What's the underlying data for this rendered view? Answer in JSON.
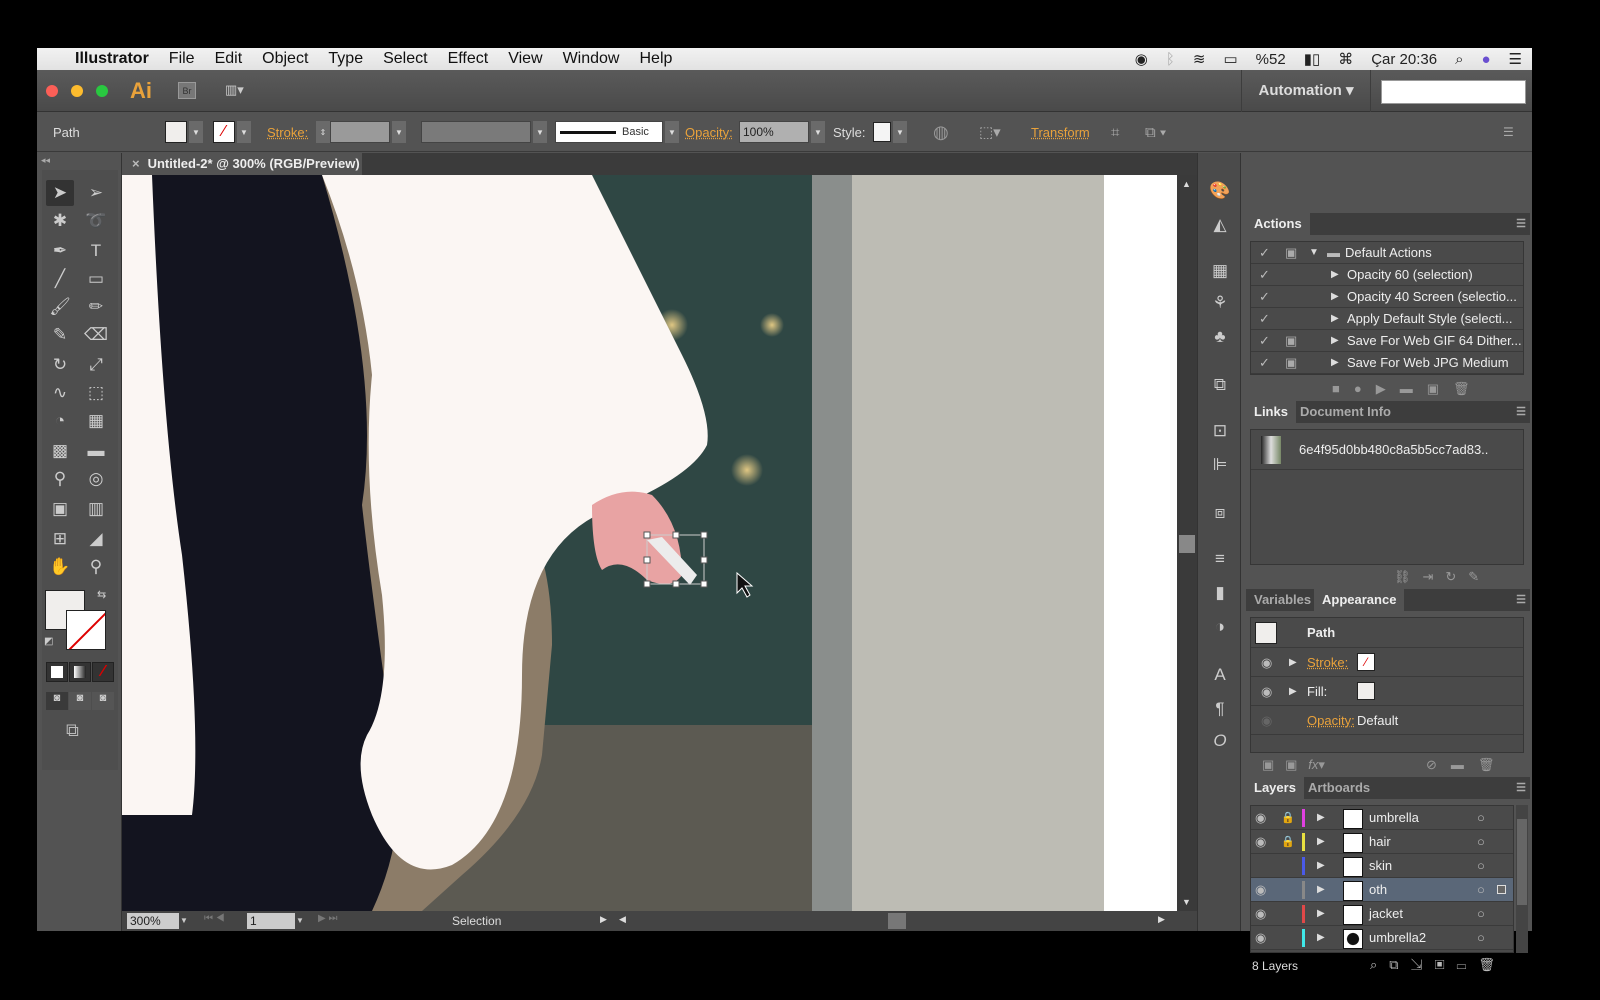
{
  "menubar": {
    "app": "Illustrator",
    "items": [
      "File",
      "Edit",
      "Object",
      "Type",
      "Select",
      "Effect",
      "View",
      "Window",
      "Help"
    ],
    "battery": "%52",
    "clock": "Çar 20:36"
  },
  "titlebar": {
    "logo": "Ai",
    "bridge": "Br",
    "workspace": "Automation"
  },
  "controlbar": {
    "selection_type": "Path",
    "stroke_label": "Stroke:",
    "brush": "Basic",
    "opacity_label": "Opacity:",
    "opacity_value": "100%",
    "style_label": "Style:",
    "transform_label": "Transform"
  },
  "document": {
    "tab_title": "Untitled-2* @ 300% (RGB/Preview)"
  },
  "statusbar": {
    "zoom": "300%",
    "artboard": "1",
    "tool_status": "Selection"
  },
  "actions": {
    "tab": "Actions",
    "set": "Default Actions",
    "items": [
      "Opacity 60 (selection)",
      "Opacity 40 Screen (selectio...",
      "Apply Default Style (selecti...",
      "Save For Web GIF 64 Dither...",
      "Save For Web JPG Medium"
    ]
  },
  "links": {
    "tabs": [
      "Links",
      "Document Info"
    ],
    "file": "6e4f95d0bb480c8a5b5cc7ad83.."
  },
  "appearance": {
    "tabs": [
      "Variables",
      "Appearance"
    ],
    "object": "Path",
    "stroke_label": "Stroke:",
    "fill_label": "Fill:",
    "opacity_label": "Opacity:",
    "opacity_value": "Default"
  },
  "layers": {
    "tabs": [
      "Layers",
      "Artboards"
    ],
    "count": "8 Layers",
    "items": [
      {
        "name": "umbrella",
        "color": "#e040e0",
        "visible": true,
        "locked": true
      },
      {
        "name": "hair",
        "color": "#e8e040",
        "visible": true,
        "locked": true
      },
      {
        "name": "skin",
        "color": "#4a5ae8",
        "visible": false,
        "locked": false
      },
      {
        "name": "oth",
        "color": "#888888",
        "visible": true,
        "locked": false,
        "selected": true
      },
      {
        "name": "jacket",
        "color": "#e04848",
        "visible": true,
        "locked": false
      },
      {
        "name": "umbrella2",
        "color": "#40e8e8",
        "visible": true,
        "locked": false
      }
    ]
  }
}
